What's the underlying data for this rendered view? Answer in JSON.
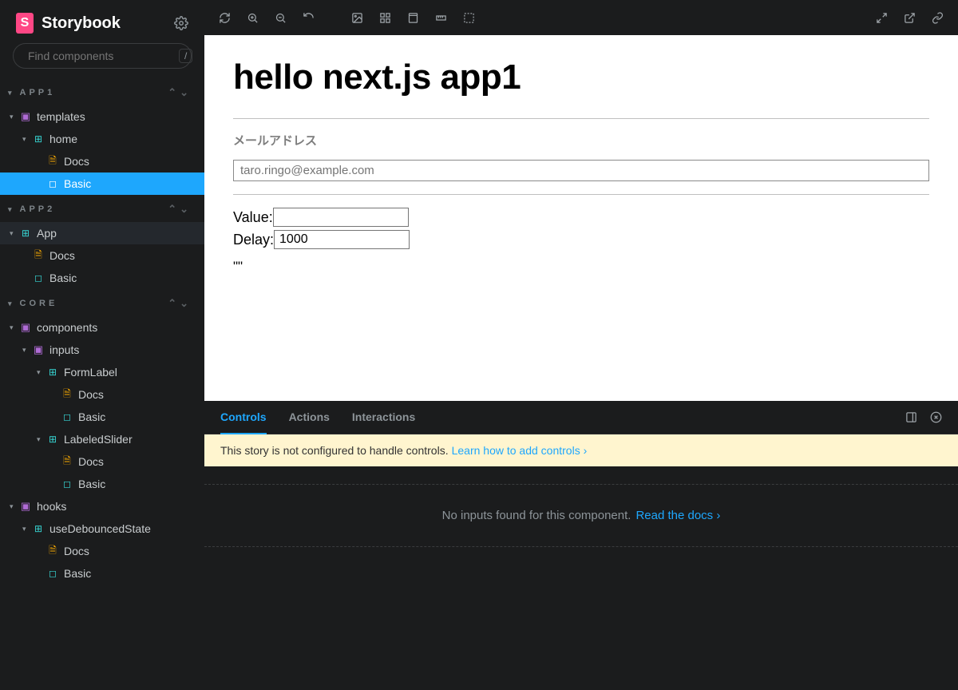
{
  "brand": {
    "mark": "S",
    "name": "Storybook"
  },
  "search": {
    "placeholder": "Find components",
    "key": "/"
  },
  "sections": {
    "app1": {
      "title": "APP1"
    },
    "app2": {
      "title": "APP2"
    },
    "core": {
      "title": "CORE"
    }
  },
  "tree": {
    "templates": "templates",
    "home": "home",
    "docs": "Docs",
    "basic": "Basic",
    "app": "App",
    "components": "components",
    "inputs": "inputs",
    "formlabel": "FormLabel",
    "labeledslider": "LabeledSlider",
    "hooks": "hooks",
    "usedebounced": "useDebouncedState"
  },
  "canvas": {
    "heading": "hello next.js app1",
    "emailLabel": "メールアドレス",
    "emailPlaceholder": "taro.ringo@example.com",
    "valueLabel": "Value:",
    "valueVal": "",
    "delayLabel": "Delay:",
    "delayVal": "1000",
    "quotes": "\"\""
  },
  "panel": {
    "tabs": {
      "controls": "Controls",
      "actions": "Actions",
      "interactions": "Interactions"
    },
    "warn": {
      "text": "This story is not configured to handle controls. ",
      "link": "Learn how to add controls"
    },
    "empty": {
      "text": "No inputs found for this component. ",
      "link": "Read the docs"
    }
  }
}
